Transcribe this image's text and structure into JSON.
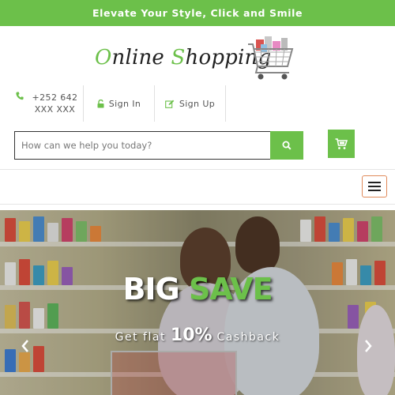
{
  "topbar": {
    "tagline": "Elevate Your Style, Click and Smile"
  },
  "logo": {
    "part1_initial": "O",
    "part1_rest": "nline ",
    "part2_initial": "S",
    "part2_rest": "hopping",
    "graphic": "shopping-cart-with-gifts"
  },
  "contact": {
    "phone": "+252 642 XXX XXX",
    "signin_label": "Sign In",
    "signup_label": "Sign Up"
  },
  "search": {
    "placeholder": "How can we help you today?",
    "value": ""
  },
  "icons": {
    "phone": "phone-icon",
    "lock": "lock-icon",
    "edit": "edit-icon",
    "search": "search-icon",
    "cart": "cart-icon",
    "menu": "hamburger-icon",
    "prev": "chevron-left-icon",
    "next": "chevron-right-icon"
  },
  "colors": {
    "accent": "#6cc04a",
    "menu_border": "#e08a5a"
  },
  "hero": {
    "title_word1": "BIG ",
    "title_word2": "SAVE",
    "sub_before": "Get flat ",
    "sub_percent": "10%",
    "sub_after": " Cashback"
  }
}
